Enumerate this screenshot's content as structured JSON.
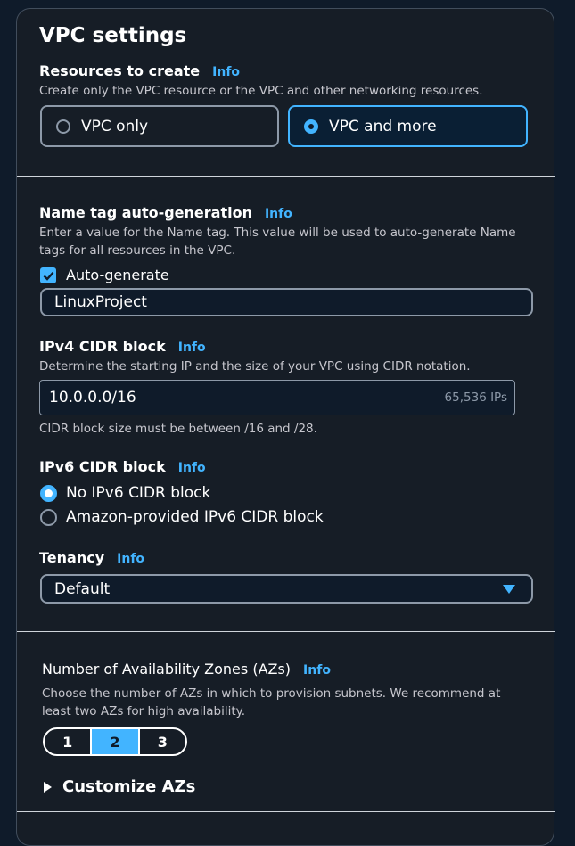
{
  "panel": {
    "title": "VPC settings",
    "info_label": "Info"
  },
  "resources": {
    "label": "Resources to create",
    "description": "Create only the VPC resource or the VPC and other networking resources.",
    "options": [
      {
        "label": "VPC only",
        "selected": false
      },
      {
        "label": "VPC and more",
        "selected": true
      }
    ]
  },
  "name_tag": {
    "label": "Name tag auto-generation",
    "description_line1": "Enter a value for the Name tag. This value will be used to auto-generate Name",
    "description_line2": "tags for all resources in the VPC.",
    "checkbox_label": "Auto-generate",
    "checked": true,
    "value": "LinuxProject"
  },
  "ipv4": {
    "label": "IPv4 CIDR block",
    "description": "Determine the starting IP and the size of your VPC using CIDR notation.",
    "value": "10.0.0.0/16",
    "suffix": "65,536 IPs",
    "constraint": "CIDR block size must be between /16 and /28."
  },
  "ipv6": {
    "label": "IPv6 CIDR block",
    "options": [
      {
        "label": "No IPv6 CIDR block",
        "selected": true
      },
      {
        "label": "Amazon-provided IPv6 CIDR block",
        "selected": false
      }
    ]
  },
  "tenancy": {
    "label": "Tenancy",
    "selected": "Default"
  },
  "azs": {
    "label": "Number of Availability Zones (AZs)",
    "description_line1": "Choose the number of AZs in which to provision subnets. We recommend at",
    "description_line2": "least two AZs for high availability.",
    "options": [
      "1",
      "2",
      "3"
    ],
    "selected": "2",
    "customize_label": "Customize AZs"
  },
  "colors": {
    "accent": "#42b4ff",
    "panel_bg": "#161d26",
    "page_bg": "#0f1b2a",
    "border": "#8d99a8"
  }
}
